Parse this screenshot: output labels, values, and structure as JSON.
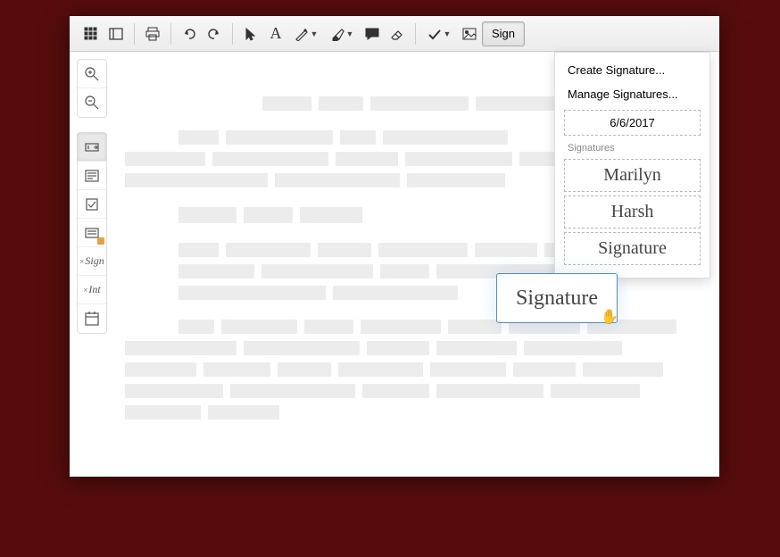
{
  "toolbar": {
    "sign_label": "Sign"
  },
  "sign_menu": {
    "create": "Create Signature...",
    "manage": "Manage Signatures...",
    "date": "6/6/2017",
    "section": "Signatures",
    "sig1": "Marilyn",
    "sig2": "Harsh",
    "sig3": "Signature"
  },
  "placed_signature": {
    "text": "Signature"
  },
  "side": {
    "sign": "Sign",
    "int": "Int"
  }
}
